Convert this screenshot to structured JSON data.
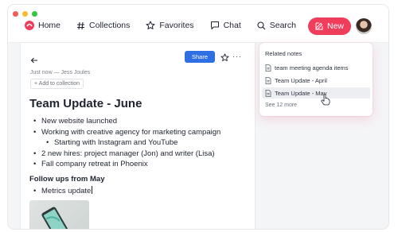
{
  "window": {
    "traffic_lights": [
      "#f45a56",
      "#f7bc2d",
      "#36c840"
    ]
  },
  "nav": {
    "home": "Home",
    "collections": "Collections",
    "favorites": "Favorites",
    "chat": "Chat",
    "search": "Search",
    "new_button": "New",
    "accent": "#ef3e5c"
  },
  "doc": {
    "share_label": "Share",
    "more_label": "···",
    "meta": "Just now — Jess Joules",
    "add_collection": "+ Add to collection",
    "title": "Team Update - June",
    "bullets": [
      "New website launched",
      "Working with creative agency for marketing campaign",
      "Starting with Instagram and YouTube",
      "2 new hires: project manager (Jon) and writer (Lisa)",
      "Fall company retreat in Phoenix"
    ],
    "followups_heading": "Follow ups from May",
    "followups": [
      "Metrics update"
    ]
  },
  "related": {
    "title": "Related notes",
    "items": [
      "team meeting agenda items",
      "Team Update - April",
      "Team Update - May"
    ],
    "hovered_index": 2,
    "see_more": "See 12 more"
  }
}
